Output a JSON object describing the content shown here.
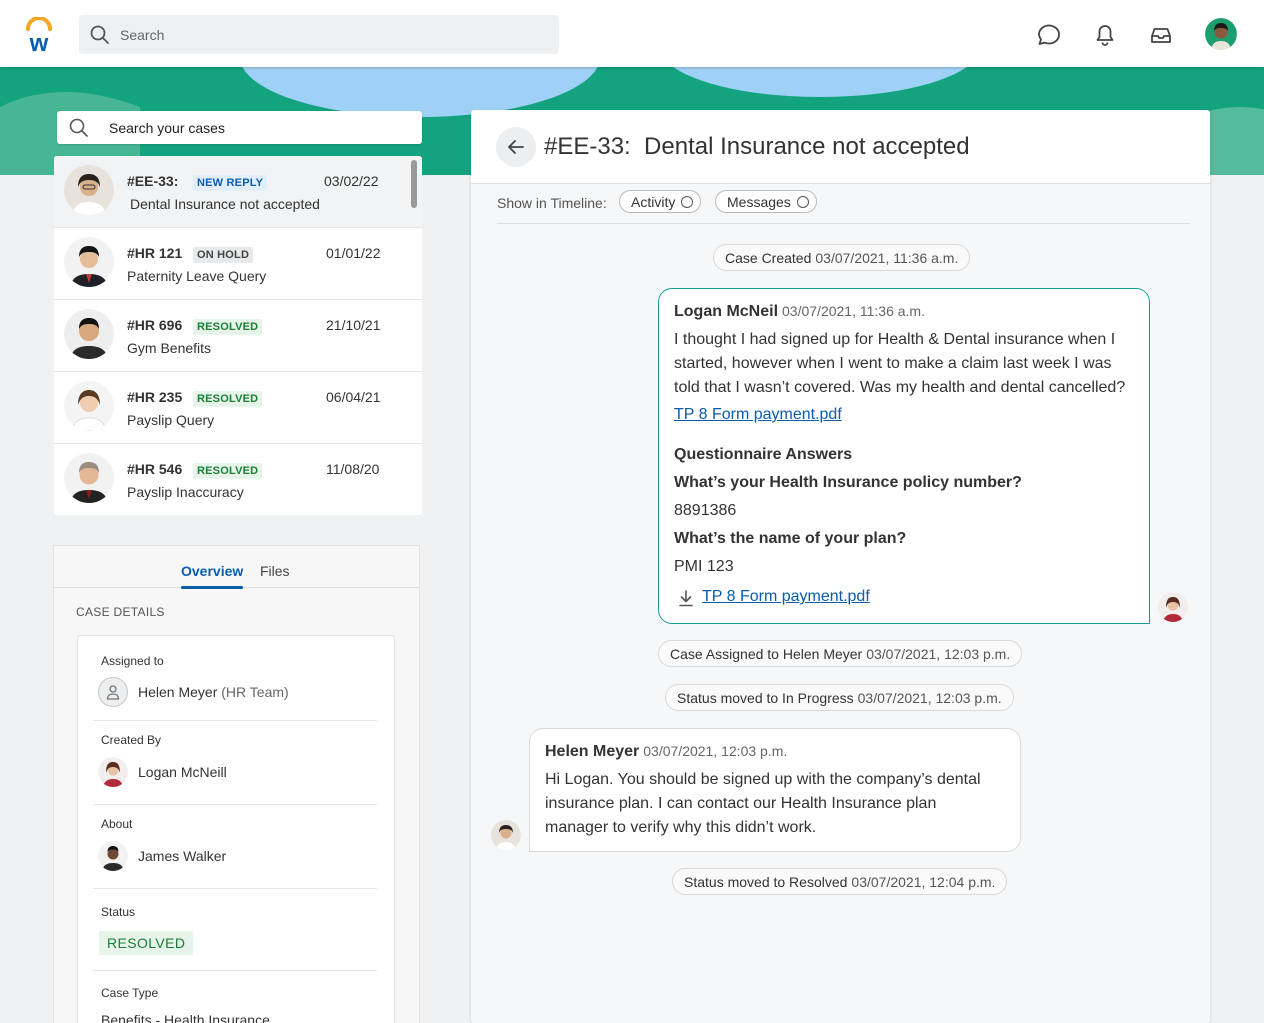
{
  "topbar": {
    "search_placeholder": "Search"
  },
  "cases": {
    "search_placeholder": "Search your cases",
    "items": [
      {
        "id": "#EE-33:",
        "badge": "NEW REPLY",
        "date": "03/02/22",
        "title": "Dental Insurance not accepted"
      },
      {
        "id": "#HR 121",
        "badge": "ON HOLD",
        "date": "01/01/22",
        "title": "Paternity Leave Query"
      },
      {
        "id": "#HR 696",
        "badge": "RESOLVED",
        "date": "21/10/21",
        "title": "Gym Benefits"
      },
      {
        "id": "#HR 235",
        "badge": "RESOLVED",
        "date": "06/04/21",
        "title": "Payslip Query"
      },
      {
        "id": "#HR 546",
        "badge": "RESOLVED",
        "date": "11/08/20",
        "title": "Payslip Inaccuracy"
      }
    ]
  },
  "details": {
    "tabs": [
      "Overview",
      "Files"
    ],
    "section_title": "CASE DETAILS",
    "assigned_label": "Assigned to",
    "assigned_name": "Helen Meyer",
    "assigned_team": "(HR Team)",
    "created_label": "Created By",
    "created_name": "Logan McNeill",
    "about_label": "About",
    "about_name": "James Walker",
    "status_label": "Status",
    "status_value": "RESOLVED",
    "type_label": "Case Type",
    "type_value": "Benefits - Health Insurance"
  },
  "case": {
    "title": "#EE-33:  Dental Insurance not accepted",
    "timeline_label": "Show in Timeline:",
    "filters": [
      "Activity",
      "Messages"
    ],
    "events": [
      {
        "text": "Case Created",
        "ts": "03/07/2021, 11:36 a.m."
      },
      {
        "text": "Case Assigned to Helen Meyer",
        "ts": "03/07/2021, 12:03 p.m."
      },
      {
        "text": "Status moved to In Progress",
        "ts": "03/07/2021, 12:03 p.m."
      },
      {
        "text": "Status moved to Resolved",
        "ts": "03/07/2021, 12:04 p.m."
      }
    ],
    "message1": {
      "author": "Logan McNeil",
      "time": "03/07/2021, 11:36 a.m.",
      "line1": "I thought I had signed up for Health & Dental insurance when I",
      "line2": "started, however when I went to make a claim last week I was",
      "line3": "told that I wasn’t covered. Was my health and dental cancelled?",
      "attachment": "TP 8 Form payment.pdf",
      "q_header": "Questionnaire Answers",
      "q1": "What’s your Health Insurance policy number?",
      "a1": "8891386",
      "q2": "What’s the name of your plan?",
      "a2": "PMI 123",
      "download": "TP 8 Form payment.pdf"
    },
    "message2": {
      "author": "Helen Meyer",
      "time": "03/07/2021, 12:03 p.m.",
      "line1": "Hi Logan. You should be signed up with the company’s dental",
      "line2": "insurance plan. I can contact our Health Insurance plan",
      "line3": "manager to verify why this didn’t work."
    }
  },
  "colors": {
    "brand_green": "#14a37f",
    "brand_blue": "#0b5cad",
    "resolved_green": "#1a7f37",
    "message_border": "#1a9a9a"
  },
  "icons": [
    "workday-logo",
    "search-icon",
    "chat-icon",
    "bell-icon",
    "inbox-icon",
    "back-arrow-icon",
    "download-icon",
    "person-icon"
  ]
}
